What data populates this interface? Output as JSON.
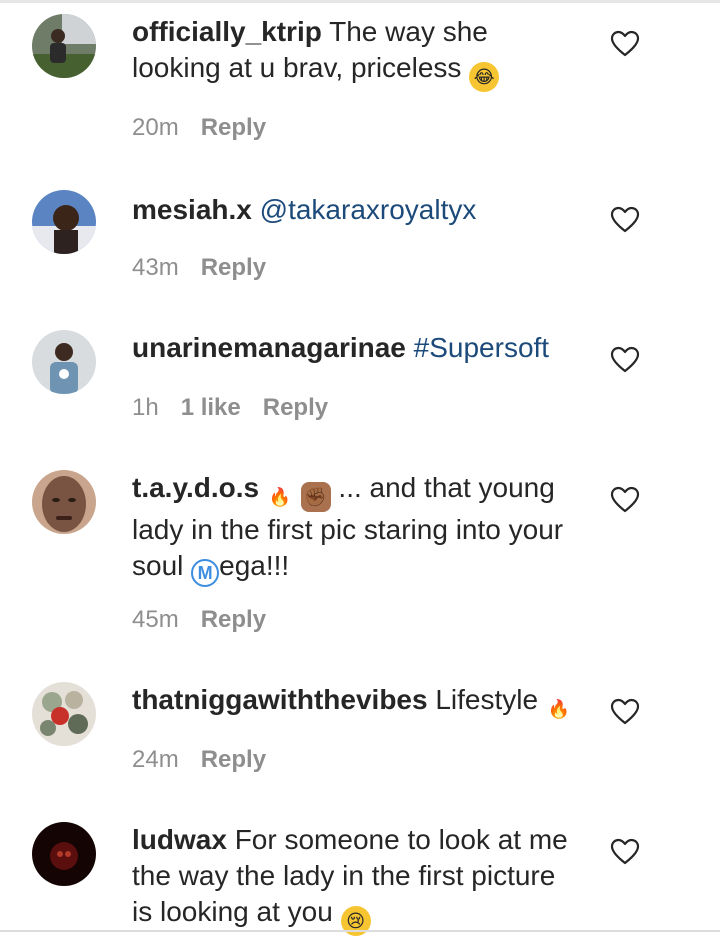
{
  "comments": [
    {
      "username": "officially_ktrip",
      "text_before": "The way she looking at u brav, priceless ",
      "emoji": "😂",
      "time": "20m",
      "likes": "",
      "reply_label": "Reply",
      "avatar_color": "#4b5a43"
    },
    {
      "username": "mesiah.x",
      "mention": "@takaraxroyaltyx",
      "time": "43m",
      "likes": "",
      "reply_label": "Reply",
      "avatar_color": "#3b5e8f"
    },
    {
      "username": "unarinemanagarinae",
      "mention": "#Supersoft",
      "time": "1h",
      "likes": "1 like",
      "reply_label": "Reply",
      "avatar_color": "#b9c0c4"
    },
    {
      "username": "t.a.y.d.o.s",
      "emoji_fire": "🔥",
      "emoji_fist": "✊🏾",
      "text_after": " ... and that young lady in the first pic staring into your soul ",
      "emoji_m": "M",
      "text_end": "ega!!!",
      "time": "45m",
      "likes": "",
      "reply_label": "Reply",
      "avatar_color": "#7a5443"
    },
    {
      "username": "thatniggawiththevibes",
      "text_before": "Lifestyle ",
      "emoji": "🔥",
      "time": "24m",
      "likes": "",
      "reply_label": "Reply",
      "avatar_color": "#5f6b57"
    },
    {
      "username": "ludwax",
      "text_before": "For someone to look at me the way the lady in the first picture is looking at you ",
      "emoji": "😢",
      "avatar_color": "#2a0a0a"
    }
  ],
  "colors": {
    "username": "#262626",
    "meta": "#8e8e8e",
    "mention": "#1c4a7a"
  },
  "icons": {
    "like": "heart-outline-icon"
  }
}
